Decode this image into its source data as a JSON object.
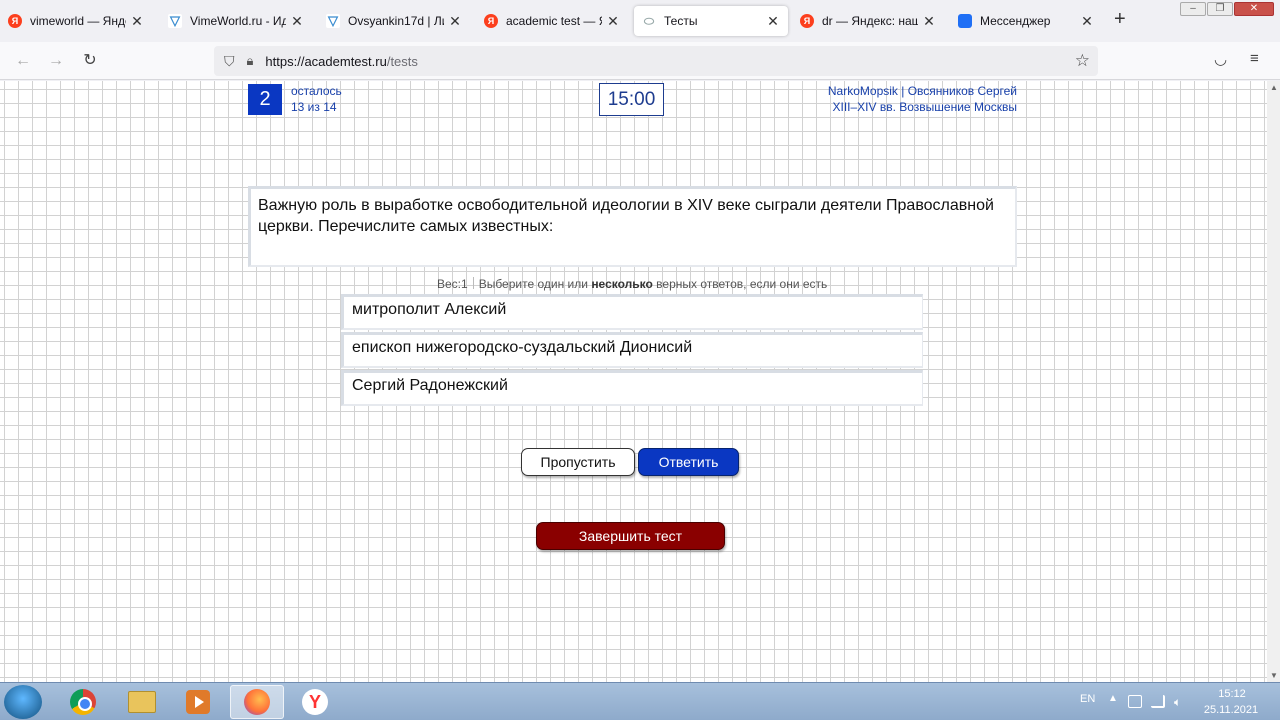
{
  "browser": {
    "tabs": [
      {
        "label": "vimeworld — Яндекс",
        "icon": "yandex-icon"
      },
      {
        "label": "VimeWorld.ru - Идеа",
        "icon": "vimeworld-icon"
      },
      {
        "label": "Ovsyankin17d | Личн",
        "icon": "vimeworld-icon"
      },
      {
        "label": "academic test — Янд",
        "icon": "yandex-icon"
      },
      {
        "label": "Тесты",
        "icon": "academtest-icon"
      },
      {
        "label": "dr — Яндекс: нашло",
        "icon": "yandex-icon"
      },
      {
        "label": "Мессенджер",
        "icon": "messenger-icon"
      }
    ],
    "active_tab": 4,
    "url_host": "https://academtest.ru",
    "url_path": "/tests"
  },
  "test": {
    "counter": "2",
    "remaining_label": "осталось",
    "remaining_count": "13 из 14",
    "timer": "15:00",
    "user": "NarkoMopsik | Овсянников Сергей",
    "topic": "XIII–XIV вв. Возвышение Москвы",
    "question": "Важную роль в выработке освободительной идеологии в XIV веке сыграли деятели Православной церкви. Перечислите самых известных:",
    "weight": "Вес:1",
    "instruction_pre": "Выберите один или",
    "instruction_bold": "несколько",
    "instruction_post": "верных ответов, если они есть",
    "answers": [
      "митрополит Алексий",
      "епископ нижегородско-суздальский Дионисий",
      "Сергий Радонежский"
    ],
    "skip_label": "Пропустить",
    "answer_label": "Ответить",
    "finish_label": "Завершить тест"
  },
  "taskbar": {
    "lang": "EN",
    "time": "15:12",
    "date": "25.11.2021"
  },
  "colors": {
    "accent": "#0a37c2",
    "finish": "#8a0000",
    "link": "#1840aa"
  }
}
